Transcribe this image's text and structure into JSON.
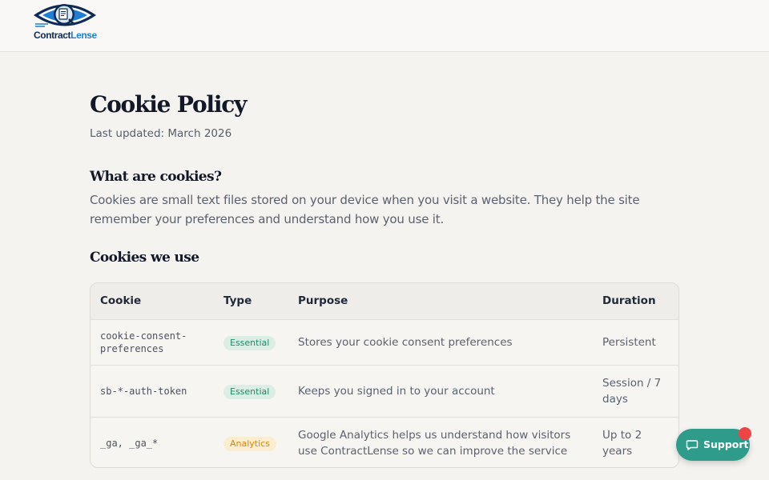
{
  "header": {
    "logo": {
      "icon": "eye-document-magnifier-logo",
      "text_main": "Contract",
      "text_accent": "Lense"
    }
  },
  "main": {
    "title": "Cookie Policy",
    "last_updated": "Last updated: March 2026",
    "sections": [
      {
        "heading": "What are cookies?",
        "body": "Cookies are small text files stored on your device when you visit a website. They help the site remember your preferences and understand how you use it."
      },
      {
        "heading": "Cookies we use"
      }
    ],
    "table": {
      "headers": [
        "Cookie",
        "Type",
        "Purpose",
        "Duration"
      ],
      "rows": [
        {
          "cookie": "cookie-consent-preferences",
          "type": "Essential",
          "purpose": "Stores your cookie consent preferences",
          "duration": "Persistent"
        },
        {
          "cookie": "sb-*-auth-token",
          "type": "Essential",
          "purpose": "Keeps you signed in to your account",
          "duration": "Session / 7 days"
        },
        {
          "cookie": "_ga, _ga_*",
          "type": "Analytics",
          "purpose": "Google Analytics helps us understand how visitors use ContractLense so we can improve the service",
          "duration": "Up to 2 years"
        }
      ]
    }
  },
  "support": {
    "label": "Support",
    "icon": "chat-bubble-icon",
    "notification": true
  },
  "colors": {
    "background": "#f5f3f0",
    "accent": "#2f9b8a",
    "essential_badge": "#1f8a63",
    "analytics_badge": "#d08a10",
    "notification": "#ef4444",
    "brand": "#0f2a56"
  }
}
